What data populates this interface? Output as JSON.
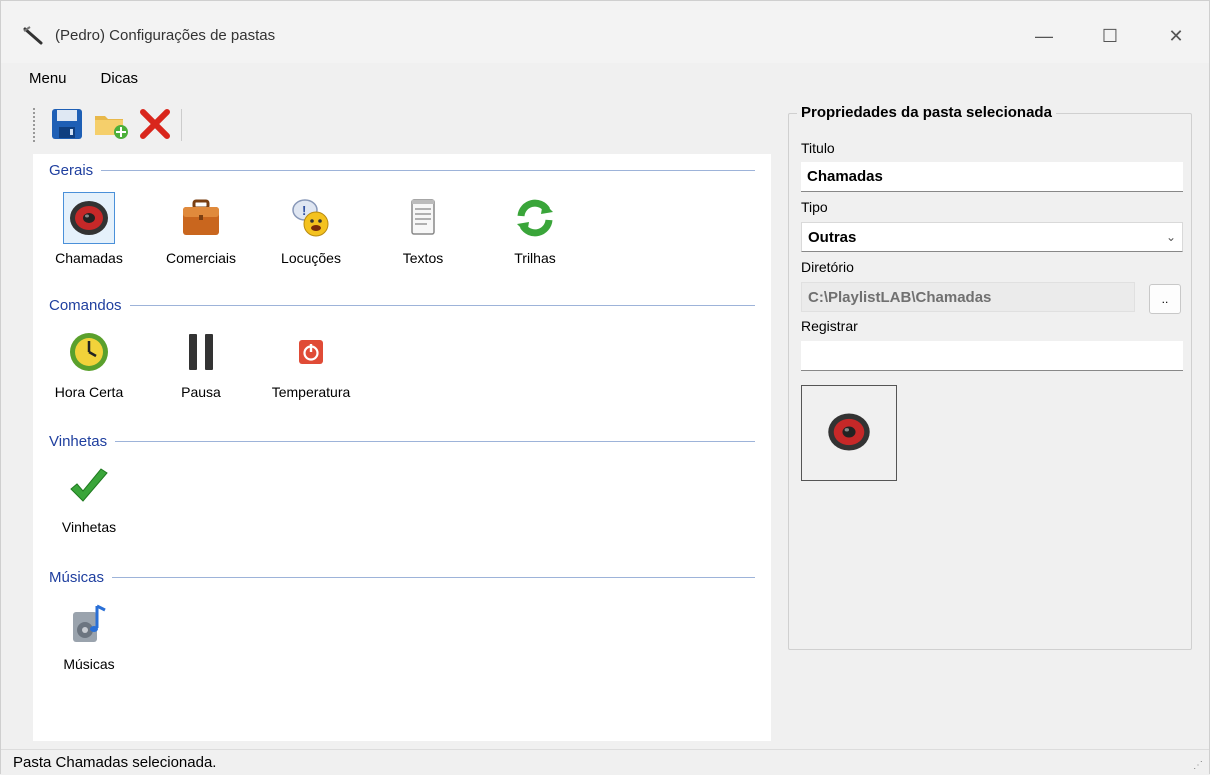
{
  "window": {
    "title": "(Pedro) Configurações de pastas",
    "minimize": "—",
    "maximize": "☐",
    "close": "✕"
  },
  "menu": [
    "Menu",
    "Dicas"
  ],
  "toolbar": {
    "buttons": [
      "save-icon",
      "new-folder-icon",
      "delete-icon"
    ]
  },
  "groups": {
    "gerais": {
      "label": "Gerais",
      "items": [
        "Chamadas",
        "Comerciais",
        "Locuções",
        "Textos",
        "Trilhas"
      ]
    },
    "comandos": {
      "label": "Comandos",
      "items": [
        "Hora Certa",
        "Pausa",
        "Temperatura"
      ]
    },
    "vinhetas": {
      "label": "Vinhetas",
      "items": [
        "Vinhetas"
      ]
    },
    "musicas": {
      "label": "Músicas",
      "items": [
        "Músicas"
      ]
    }
  },
  "selected_item": "Chamadas",
  "properties": {
    "legend": "Propriedades da pasta selecionada",
    "titulo_label": "Titulo",
    "titulo_value": "Chamadas",
    "tipo_label": "Tipo",
    "tipo_value": "Outras",
    "diretorio_label": "Diretório",
    "diretorio_value": "C:\\PlaylistLAB\\Chamadas",
    "browse_label": "..",
    "registrar_label": "Registrar",
    "registrar_value": ""
  },
  "status": "Pasta Chamadas selecionada.",
  "colors": {
    "group_header": "#1f3f9f",
    "selection_border": "#4a90d9",
    "accent_red": "#d9261c",
    "accent_green": "#3aa53a"
  }
}
